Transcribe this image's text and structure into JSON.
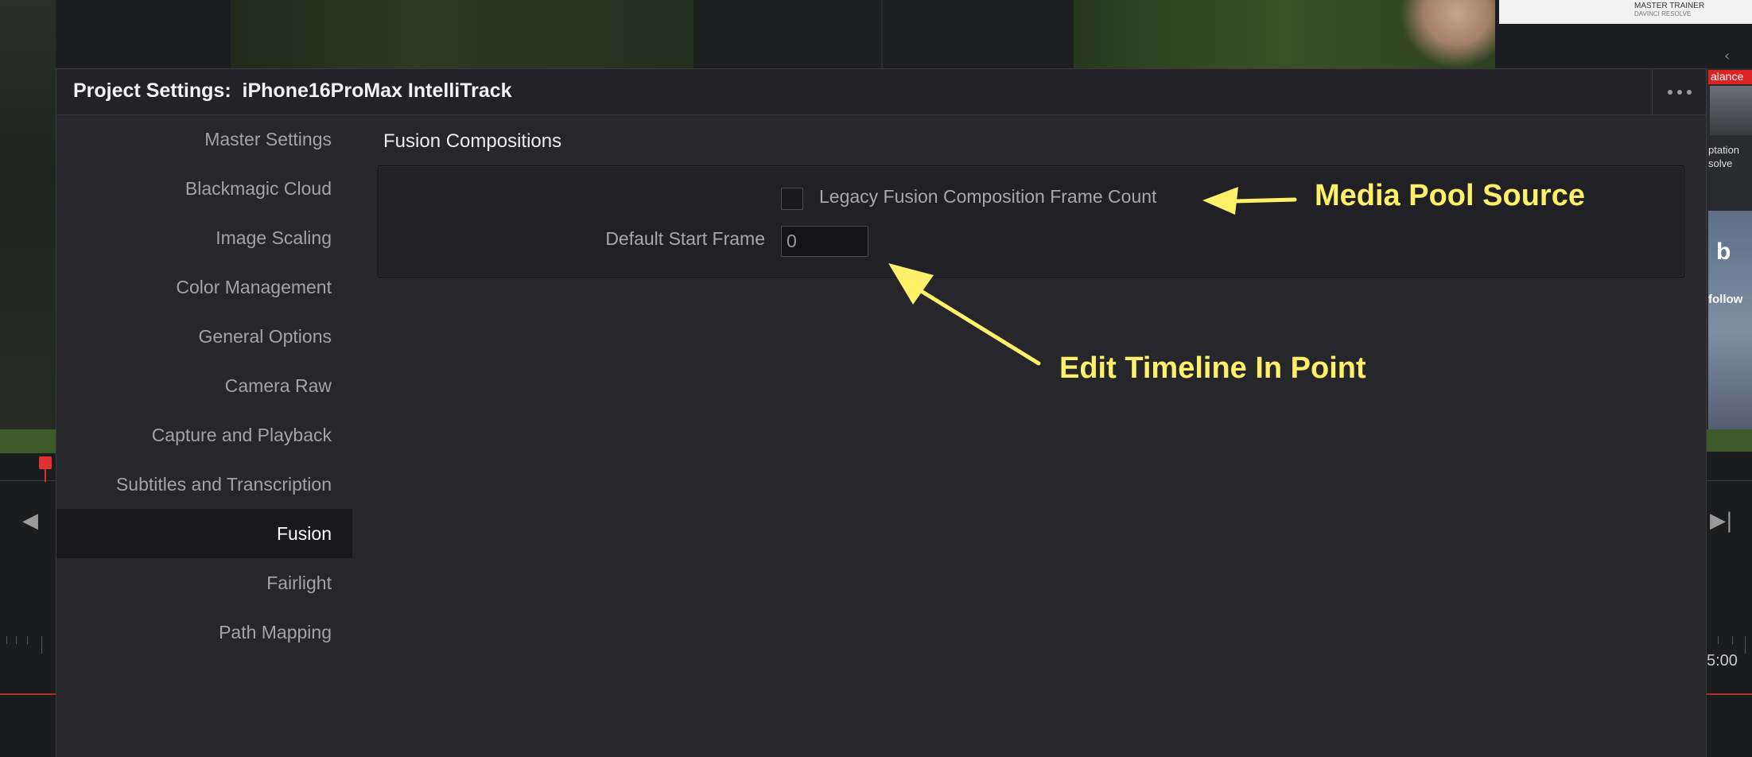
{
  "background": {
    "thumbnail_title": "MASTER TRAINER",
    "thumbnail_subtitle": "DAVINCI RESOLVE",
    "right_badge": "alance",
    "right_caption": "ptation solve",
    "right_letter": "b",
    "right_follow": "follow",
    "timecode": "5:00"
  },
  "dialog": {
    "title": "Project Settings:  iPhone16ProMax IntelliTrack",
    "menu_icon": "ellipsis-icon"
  },
  "sidebar": {
    "items": [
      {
        "label": "Master Settings",
        "active": false
      },
      {
        "label": "Blackmagic Cloud",
        "active": false
      },
      {
        "label": "Image Scaling",
        "active": false
      },
      {
        "label": "Color Management",
        "active": false
      },
      {
        "label": "General Options",
        "active": false
      },
      {
        "label": "Camera Raw",
        "active": false
      },
      {
        "label": "Capture and Playback",
        "active": false
      },
      {
        "label": "Subtitles and Transcription",
        "active": false
      },
      {
        "label": "Fusion",
        "active": true
      },
      {
        "label": "Fairlight",
        "active": false
      },
      {
        "label": "Path Mapping",
        "active": false
      }
    ]
  },
  "fusion": {
    "section_title": "Fusion Compositions",
    "legacy_frame_count": {
      "label": "Legacy Fusion Composition Frame Count",
      "checked": false
    },
    "default_start_frame": {
      "label": "Default Start Frame",
      "value": "0"
    }
  },
  "annotations": {
    "media_pool_source": "Media Pool Source",
    "edit_timeline_in_point": "Edit Timeline In Point",
    "color": "#fff06a"
  }
}
